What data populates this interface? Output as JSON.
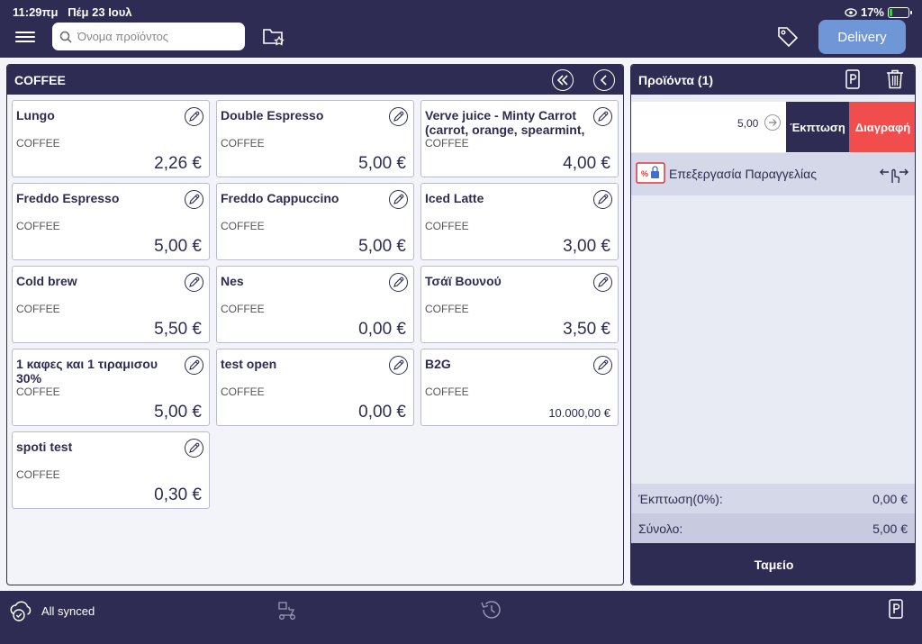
{
  "status_bar": {
    "time": "11:29πμ",
    "date": "Πέμ 23 Ιουλ",
    "battery": "17%",
    "battery_level": 0.17
  },
  "topbar": {
    "search_placeholder": "Όνομα προϊόντος",
    "delivery_label": "Delivery"
  },
  "category": {
    "title": "COFFEE"
  },
  "products": [
    {
      "name": "Lungo",
      "category": "COFFEE",
      "price": "2,26 €"
    },
    {
      "name": "Double Espresso",
      "category": "COFFEE",
      "price": "5,00 €"
    },
    {
      "name": "Verve juice - Minty Carrot (carrot, orange, spearmint,",
      "category": "COFFEE",
      "price": "4,00 €"
    },
    {
      "name": "Freddo Espresso",
      "category": "COFFEE",
      "price": "5,00 €"
    },
    {
      "name": "Freddo Cappuccino",
      "category": "COFFEE",
      "price": "5,00 €"
    },
    {
      "name": "Iced Latte",
      "category": "COFFEE",
      "price": "3,00 €"
    },
    {
      "name": "Cold brew",
      "category": "COFFEE",
      "price": "5,50 €"
    },
    {
      "name": "Nes",
      "category": "COFFEE",
      "price": "0,00 €"
    },
    {
      "name": "Τσάϊ Βουνού",
      "category": "COFFEE",
      "price": "3,50 €"
    },
    {
      "name": "1 καφες και 1 τιραμισου 30%",
      "category": "COFFEE",
      "price": "5,00 €"
    },
    {
      "name": "test open",
      "category": "COFFEE",
      "price": "0,00 €"
    },
    {
      "name": "B2G",
      "category": "COFFEE",
      "price": "10.000,00 €"
    },
    {
      "name": "spoti test",
      "category": "COFFEE",
      "price": "0,30 €"
    }
  ],
  "cart": {
    "title": "Προϊόντα (1)",
    "item_price": "5,00",
    "discount_label": "Έκπτωση",
    "delete_label": "Διαγραφή",
    "edit_order_label": "Επεξεργασία Παραγγελίας",
    "discount_total_label": "Έκπτωση(0%):",
    "discount_total_value": "0,00 €",
    "total_label": "Σύνολο:",
    "total_value": "5,00 €",
    "checkout_label": "Ταμείο"
  },
  "bottom": {
    "sync_label": "All synced"
  }
}
